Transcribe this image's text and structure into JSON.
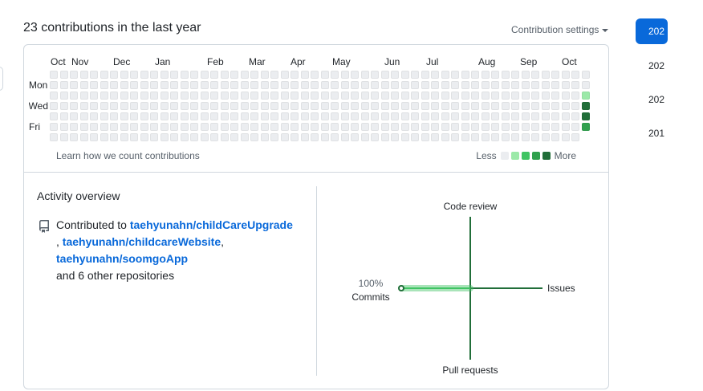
{
  "header": {
    "title": "23 contributions in the last year",
    "settings_label": "Contribution settings"
  },
  "calendar": {
    "months": [
      "Oct",
      "Nov",
      "Dec",
      "Jan",
      "Feb",
      "Mar",
      "Apr",
      "May",
      "Jun",
      "Jul",
      "Aug",
      "Sep",
      "Oct"
    ],
    "days": [
      "Mon",
      "Wed",
      "Fri"
    ],
    "learn_link": "Learn how we count contributions",
    "legend_less": "Less",
    "legend_more": "More",
    "colors": [
      "#ebedf0",
      "#9be9a8",
      "#40c463",
      "#30a14e",
      "#216e39"
    ],
    "weeks": 54,
    "active_cells": [
      {
        "week": 53,
        "day": 2,
        "level": 1
      },
      {
        "week": 53,
        "day": 3,
        "level": 4
      },
      {
        "week": 53,
        "day": 4,
        "level": 4
      },
      {
        "week": 53,
        "day": 5,
        "level": 3
      }
    ]
  },
  "activity": {
    "title": "Activity overview",
    "prefix": "Contributed to",
    "repo1": "taehyunahn/childCareUpgrade",
    "repo2": "taehyunahn/childcareWebsite",
    "repo3": "taehyunahn/soomgoApp",
    "others": "and 6 other repositories"
  },
  "overview": {
    "code_review": "Code review",
    "issues": "Issues",
    "pull_requests": "Pull requests",
    "commits_pct": "100%",
    "commits": "Commits",
    "axis_color": "#216e39",
    "highlight_color": "#40c463"
  },
  "sidebar": {
    "years": [
      "202",
      "202",
      "202",
      "201"
    ]
  }
}
